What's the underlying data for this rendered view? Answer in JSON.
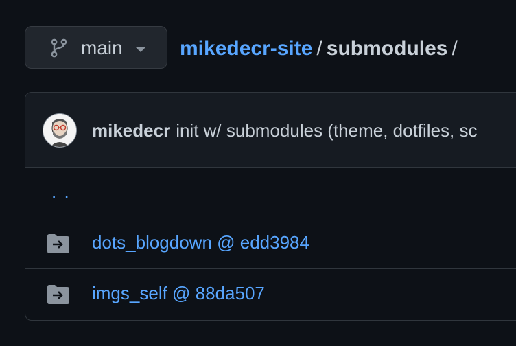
{
  "branch": {
    "name": "main",
    "icon": "git-branch-icon"
  },
  "breadcrumb": {
    "repo": "mikedecr-site",
    "separator": "/",
    "directory": "submodules",
    "trailing_separator": "/"
  },
  "commit": {
    "author": "mikedecr",
    "message": "init w/ submodules (theme, dotfiles, sc"
  },
  "parent_directory": {
    "label": ". ."
  },
  "entries": [
    {
      "name": "dots_blogdown @ edd3984",
      "icon": "submodule-folder-icon"
    },
    {
      "name": "imgs_self @ 88da507",
      "icon": "submodule-folder-icon"
    }
  ],
  "colors": {
    "background": "#0d1117",
    "link": "#58a6ff",
    "text": "#c9d1d9",
    "border": "#30363d"
  }
}
